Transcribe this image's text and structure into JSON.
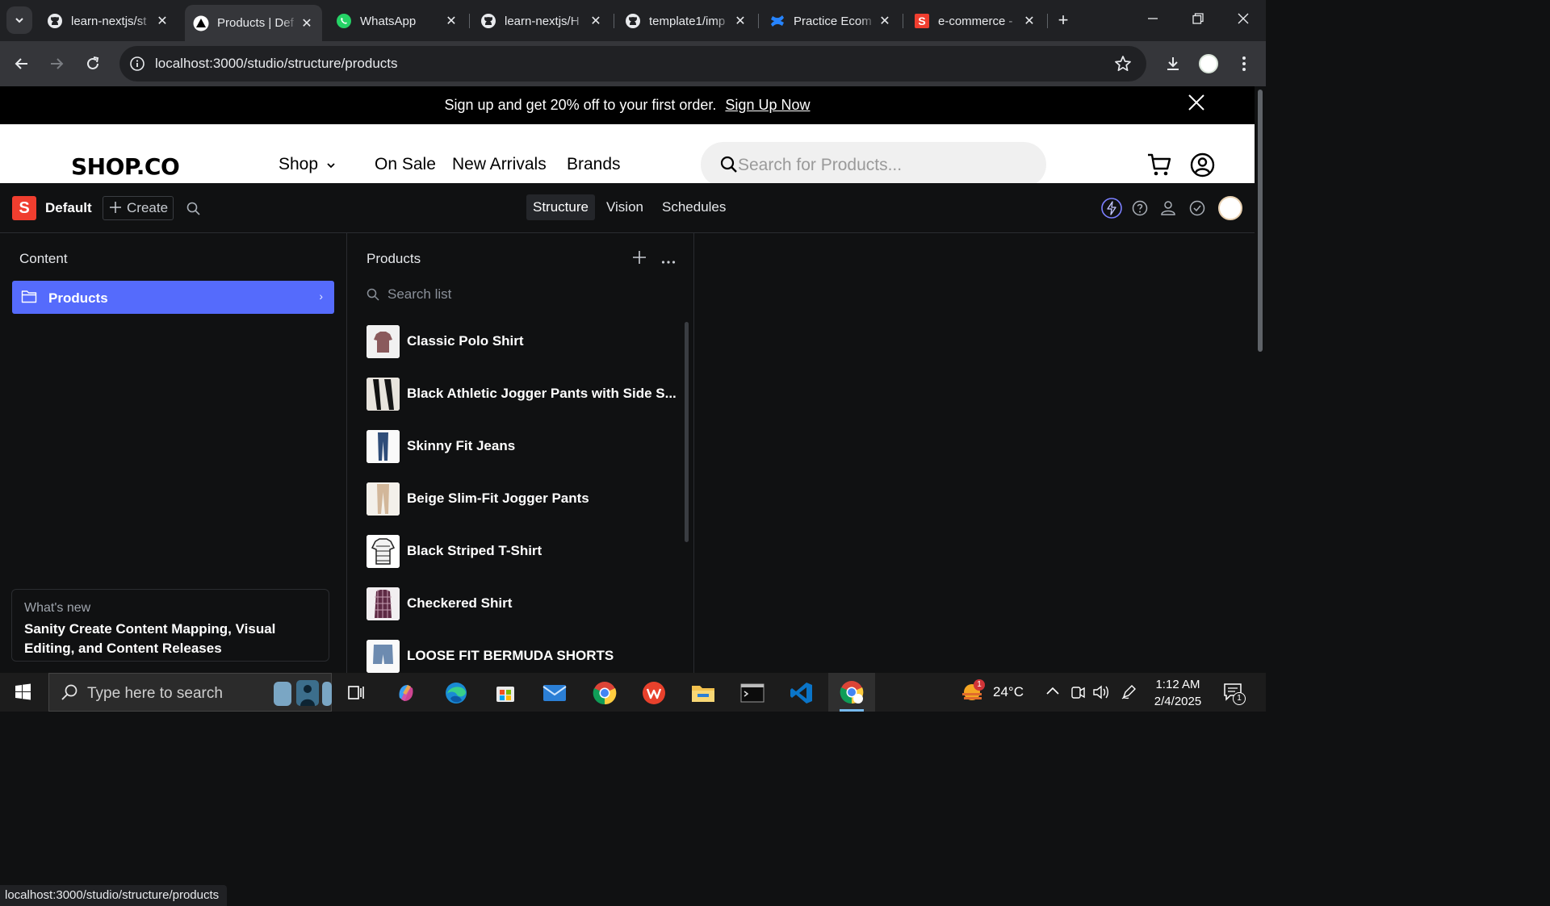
{
  "browser": {
    "tabs": [
      {
        "title": "learn-nextjs/st",
        "icon": "github-icon",
        "active": false
      },
      {
        "title": "Products | Def",
        "icon": "nextjs-icon",
        "active": true
      },
      {
        "title": "WhatsApp",
        "icon": "whatsapp-icon",
        "active": false
      },
      {
        "title": "learn-nextjs/H",
        "icon": "github-icon",
        "active": false
      },
      {
        "title": "template1/imp",
        "icon": "github-icon",
        "active": false
      },
      {
        "title": "Practice Ecom",
        "icon": "confluence-icon",
        "active": false
      },
      {
        "title": "e-commerce -",
        "icon": "sanity-icon",
        "active": false
      }
    ],
    "url": "localhost:3000/studio/structure/products",
    "status_url": "localhost:3000/studio/structure/products"
  },
  "site": {
    "banner": {
      "text": "Sign up and get 20% off to your first order.",
      "link": "Sign Up Now"
    },
    "logo": "SHOP.CO",
    "nav": {
      "shop": "Shop",
      "on_sale": "On Sale",
      "new_arrivals": "New Arrivals",
      "brands": "Brands"
    },
    "search_placeholder": "Search for Products..."
  },
  "studio": {
    "logo_letter": "S",
    "workspace": "Default",
    "create_label": "Create",
    "tabs": {
      "structure": "Structure",
      "vision": "Vision",
      "schedules": "Schedules"
    },
    "content_pane": {
      "title": "Content",
      "item": "Products"
    },
    "whats_new": {
      "kicker": "What's new",
      "title": "Sanity Create Content Mapping, Visual Editing, and Content Releases"
    },
    "products_pane": {
      "title": "Products",
      "search_placeholder": "Search list",
      "items": [
        {
          "name": "Classic Polo Shirt"
        },
        {
          "name": "Black Athletic Jogger Pants with Side S..."
        },
        {
          "name": "Skinny Fit Jeans"
        },
        {
          "name": "Beige Slim-Fit Jogger Pants"
        },
        {
          "name": "Black Striped T-Shirt"
        },
        {
          "name": "Checkered Shirt"
        },
        {
          "name": "LOOSE FIT BERMUDA SHORTS"
        }
      ]
    },
    "accent_color": "#556bfc"
  },
  "taskbar": {
    "search_placeholder": "Type here to search",
    "weather": "24°C",
    "notification_count": "1",
    "weather_badge": "1",
    "time": "1:12 AM",
    "date": "2/4/2025"
  }
}
